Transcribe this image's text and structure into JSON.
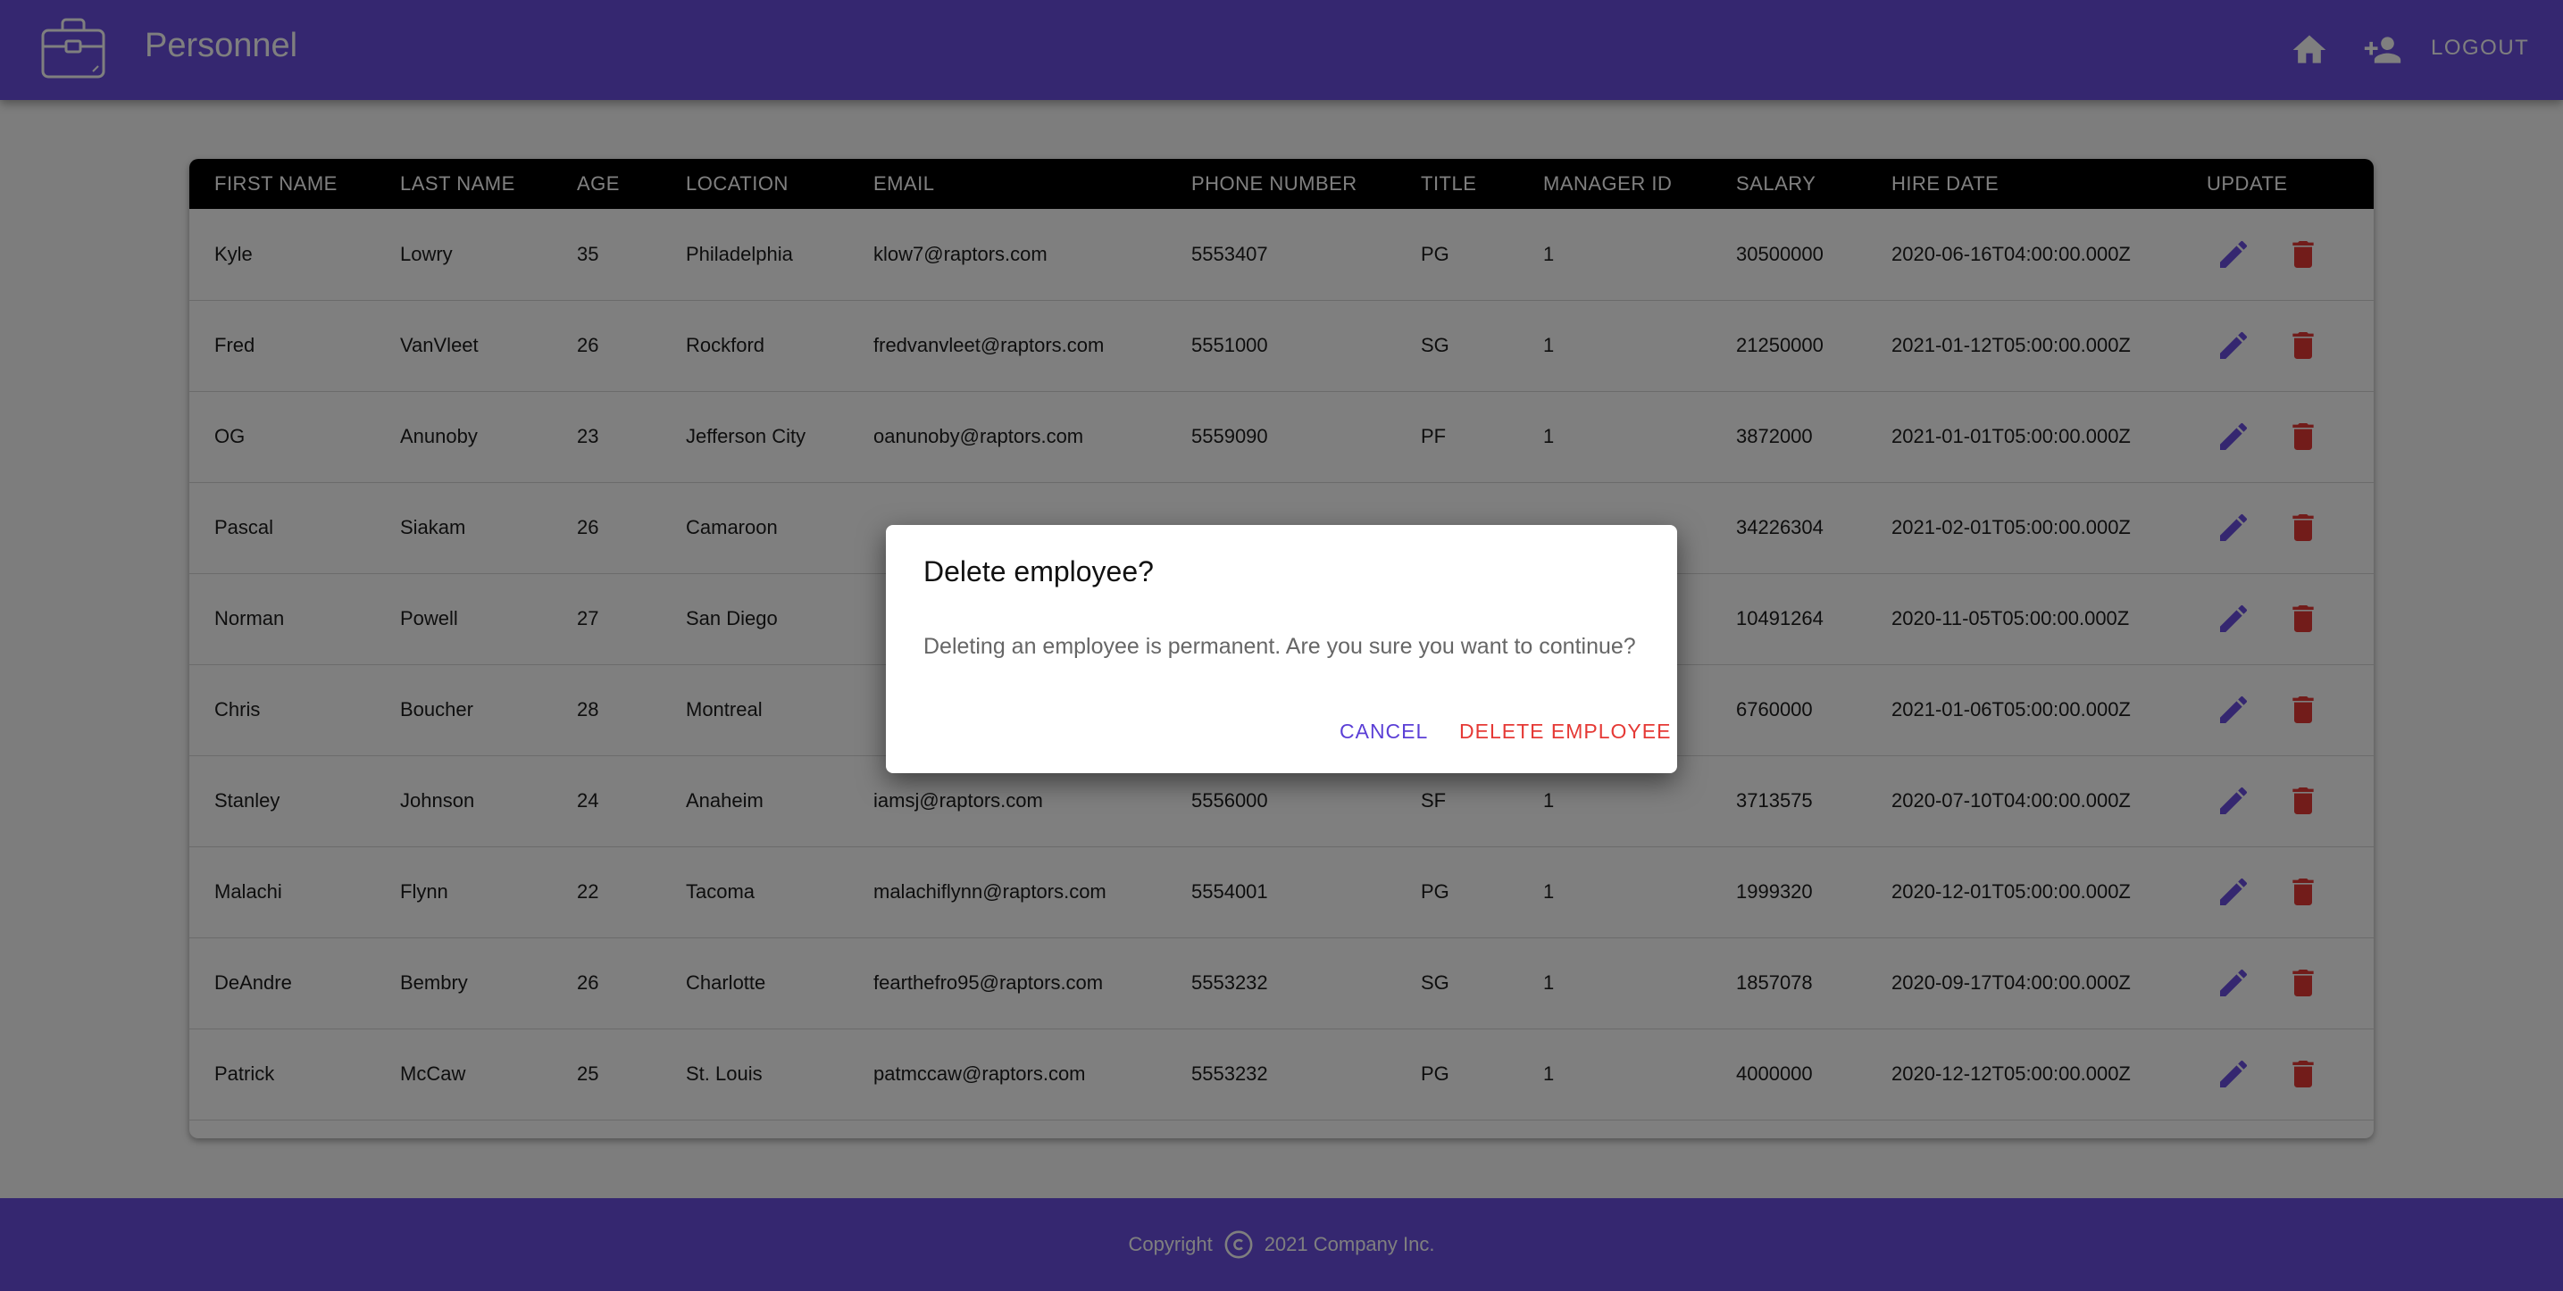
{
  "header": {
    "title": "Personnel",
    "logo_icon": "briefcase-icon",
    "home_icon": "home-icon",
    "add_user_icon": "person-add-icon",
    "logout_label": "LOGOUT"
  },
  "table": {
    "columns": [
      "FIRST NAME",
      "LAST NAME",
      "AGE",
      "LOCATION",
      "EMAIL",
      "PHONE NUMBER",
      "TITLE",
      "MANAGER ID",
      "SALARY",
      "HIRE DATE",
      "UPDATE"
    ],
    "rows": [
      {
        "first": "Kyle",
        "last": "Lowry",
        "age": "35",
        "location": "Philadelphia",
        "email": "klow7@raptors.com",
        "phone": "5553407",
        "title": "PG",
        "manager": "1",
        "salary": "30500000",
        "hire": "2020-06-16T04:00:00.000Z"
      },
      {
        "first": "Fred",
        "last": "VanVleet",
        "age": "26",
        "location": "Rockford",
        "email": "fredvanvleet@raptors.com",
        "phone": "5551000",
        "title": "SG",
        "manager": "1",
        "salary": "21250000",
        "hire": "2021-01-12T05:00:00.000Z"
      },
      {
        "first": "OG",
        "last": "Anunoby",
        "age": "23",
        "location": "Jefferson City",
        "email": "oanunoby@raptors.com",
        "phone": "5559090",
        "title": "PF",
        "manager": "1",
        "salary": "3872000",
        "hire": "2021-01-01T05:00:00.000Z"
      },
      {
        "first": "Pascal",
        "last": "Siakam",
        "age": "26",
        "location": "Camaroon",
        "email": "",
        "phone": "",
        "title": "",
        "manager": "",
        "salary": "34226304",
        "hire": "2021-02-01T05:00:00.000Z"
      },
      {
        "first": "Norman",
        "last": "Powell",
        "age": "27",
        "location": "San Diego",
        "email": "",
        "phone": "",
        "title": "",
        "manager": "",
        "salary": "10491264",
        "hire": "2020-11-05T05:00:00.000Z"
      },
      {
        "first": "Chris",
        "last": "Boucher",
        "age": "28",
        "location": "Montreal",
        "email": "",
        "phone": "",
        "title": "",
        "manager": "",
        "salary": "6760000",
        "hire": "2021-01-06T05:00:00.000Z"
      },
      {
        "first": "Stanley",
        "last": "Johnson",
        "age": "24",
        "location": "Anaheim",
        "email": "iamsj@raptors.com",
        "phone": "5556000",
        "title": "SF",
        "manager": "1",
        "salary": "3713575",
        "hire": "2020-07-10T04:00:00.000Z"
      },
      {
        "first": "Malachi",
        "last": "Flynn",
        "age": "22",
        "location": "Tacoma",
        "email": "malachiflynn@raptors.com",
        "phone": "5554001",
        "title": "PG",
        "manager": "1",
        "salary": "1999320",
        "hire": "2020-12-01T05:00:00.000Z"
      },
      {
        "first": "DeAndre",
        "last": "Bembry",
        "age": "26",
        "location": "Charlotte",
        "email": "fearthefro95@raptors.com",
        "phone": "5553232",
        "title": "SG",
        "manager": "1",
        "salary": "1857078",
        "hire": "2020-09-17T04:00:00.000Z"
      },
      {
        "first": "Patrick",
        "last": "McCaw",
        "age": "25",
        "location": "St. Louis",
        "email": "patmccaw@raptors.com",
        "phone": "5553232",
        "title": "PG",
        "manager": "1",
        "salary": "4000000",
        "hire": "2020-12-12T05:00:00.000Z"
      }
    ],
    "edit_icon": "pencil-icon",
    "delete_icon": "trash-icon"
  },
  "dialog": {
    "title": "Delete employee?",
    "message": "Deleting an employee is permanent. Are you sure you want to continue?",
    "cancel_label": "CANCEL",
    "confirm_label": "DELETE EMPLOYEE"
  },
  "footer": {
    "prefix": "Copyright",
    "copyright_icon": "copyright-icon",
    "suffix": "2021 Company Inc."
  },
  "colors": {
    "primary": "#6a4fe0",
    "danger": "#e53935",
    "header_row": "#000000"
  }
}
